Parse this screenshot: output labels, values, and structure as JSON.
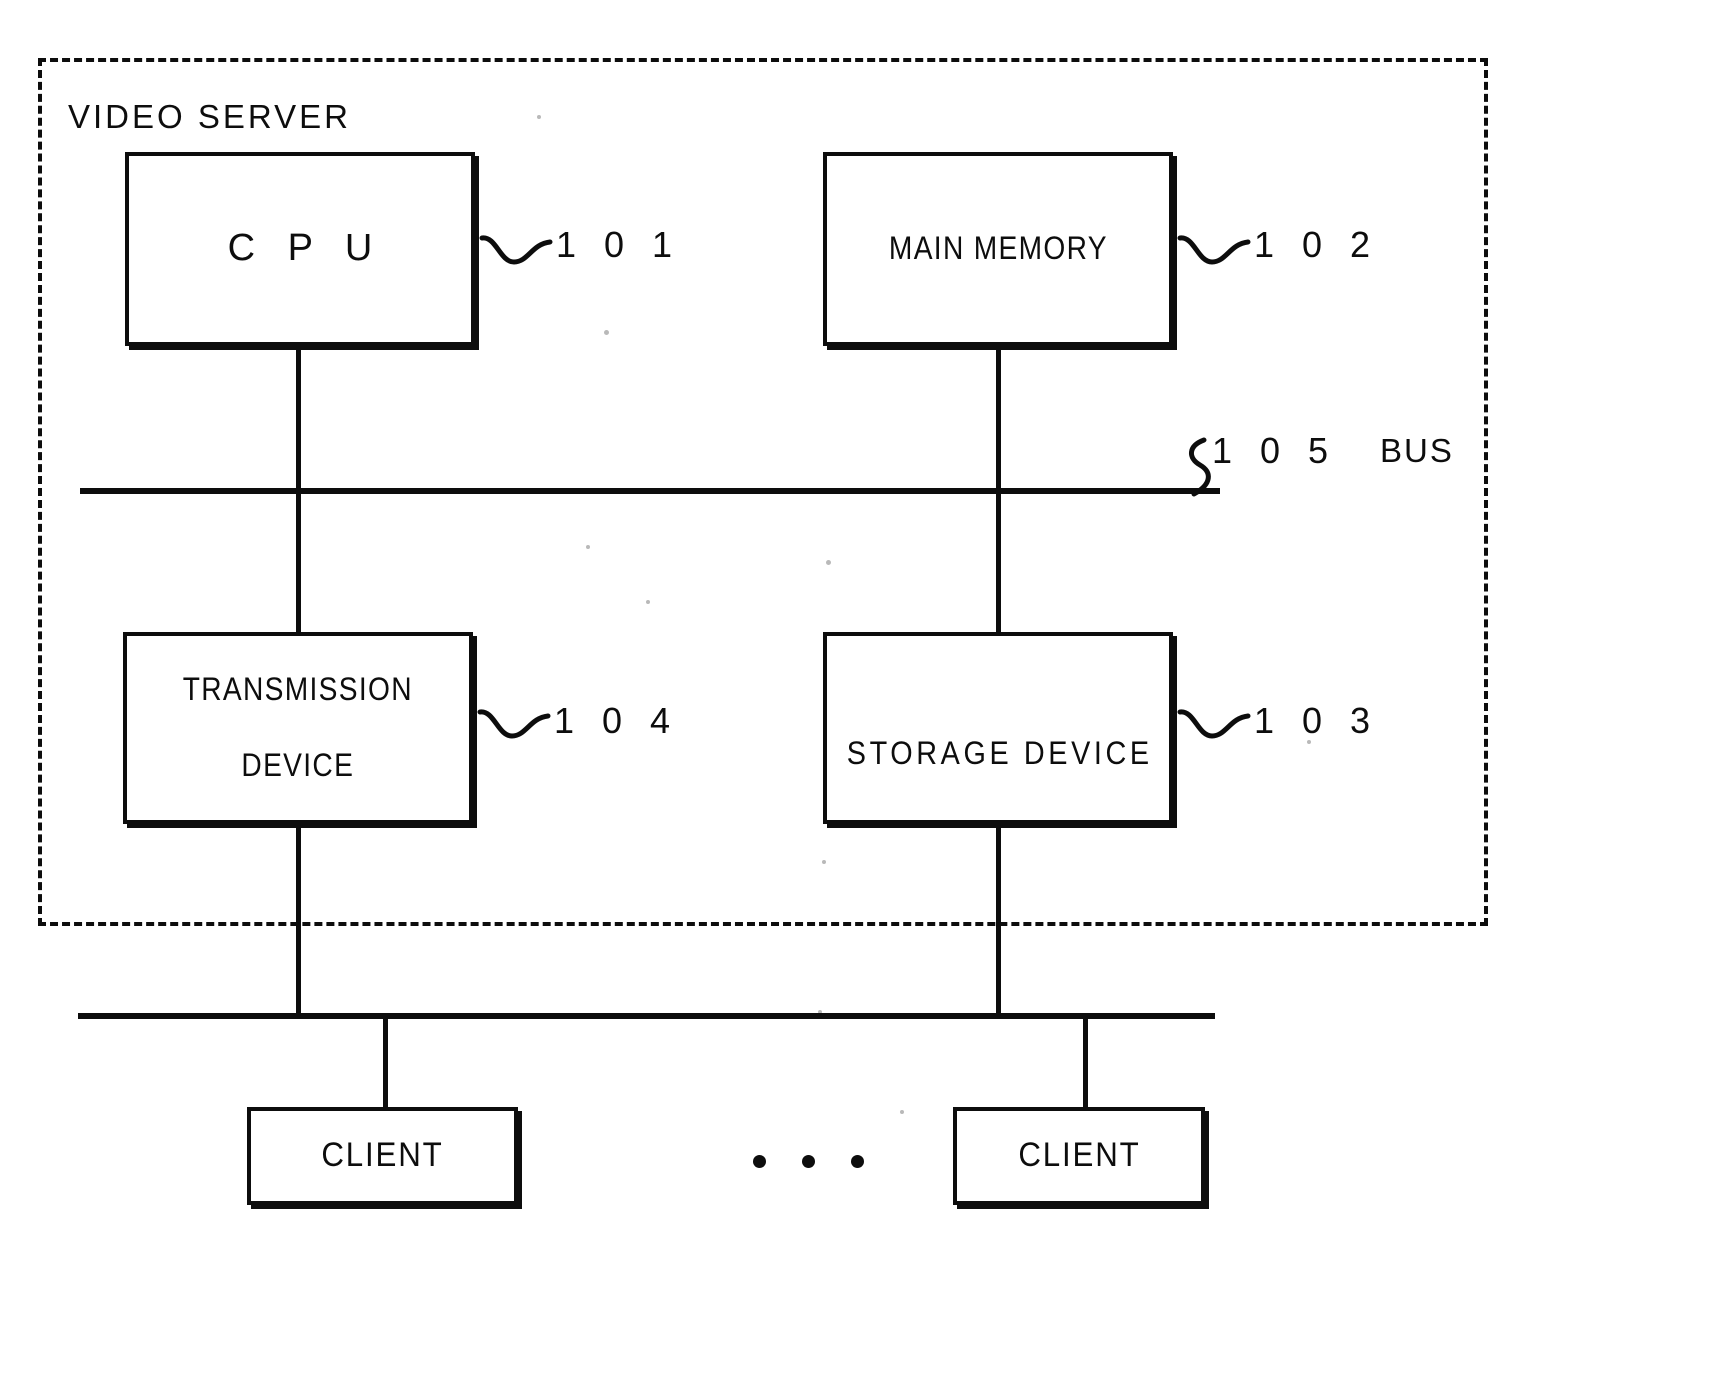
{
  "figure": {
    "type": "block-diagram",
    "enclosure": {
      "label": "VIDEO SERVER",
      "style": "dashed"
    },
    "nodes": [
      {
        "id": "cpu",
        "label": "C P U",
        "ref": "1 0 1"
      },
      {
        "id": "main-memory",
        "label": "MAIN MEMORY",
        "ref": "1 0 2"
      },
      {
        "id": "transmission",
        "label_line1": "TRANSMISSION",
        "label_line2": "DEVICE",
        "ref": "1 0 4"
      },
      {
        "id": "storage",
        "label": "STORAGE DEVICE",
        "ref": "1 0 3"
      },
      {
        "id": "client-left",
        "label": "CLIENT"
      },
      {
        "id": "client-right",
        "label": "CLIENT"
      }
    ],
    "buses": [
      {
        "id": "internal-bus",
        "ref": "1 0 5",
        "name": "BUS"
      },
      {
        "id": "network-bus"
      }
    ],
    "ellipsis": "• • •",
    "colors": {
      "ink": "#0d0d0d",
      "paper": "#ffffff"
    }
  }
}
